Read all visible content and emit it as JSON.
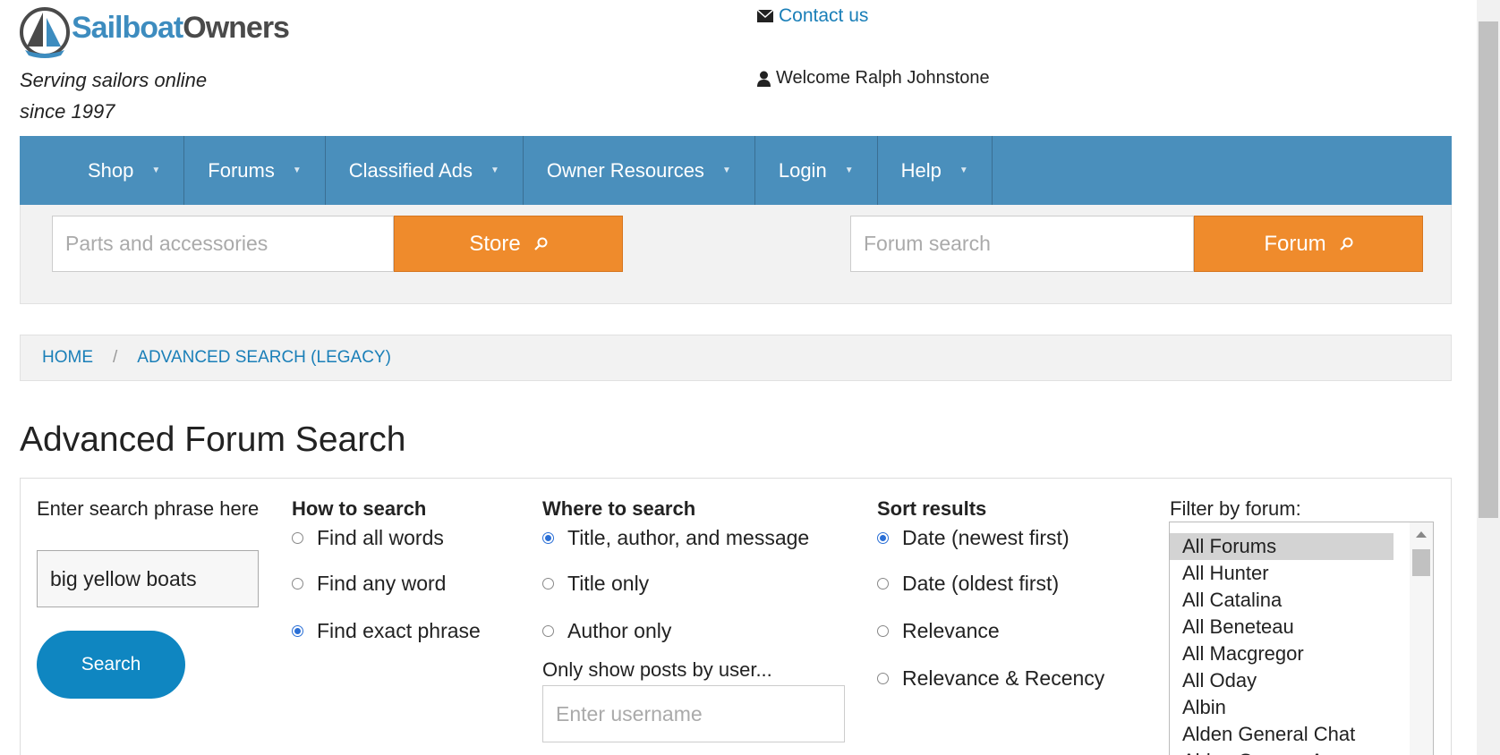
{
  "header": {
    "logo_sail": "Sailboat",
    "logo_owners": "Owners",
    "tagline_line1": "Serving sailors online",
    "tagline_line2": "since 1997",
    "contact_label": "Contact us",
    "welcome_text": "Welcome Ralph Johnstone"
  },
  "nav": {
    "items": [
      {
        "label": "Shop"
      },
      {
        "label": "Forums"
      },
      {
        "label": "Classified Ads"
      },
      {
        "label": "Owner Resources"
      },
      {
        "label": "Login"
      },
      {
        "label": "Help"
      }
    ]
  },
  "search_strip": {
    "store_placeholder": "Parts and accessories",
    "store_button": "Store",
    "forum_placeholder": "Forum search",
    "forum_button": "Forum"
  },
  "breadcrumb": {
    "home": "HOME",
    "separator": "/",
    "current": "ADVANCED SEARCH (LEGACY)"
  },
  "page_title": "Advanced Forum Search",
  "form": {
    "phrase_label": "Enter search phrase here",
    "phrase_value": "big yellow boats",
    "search_button": "Search",
    "how": {
      "heading": "How to search",
      "options": [
        {
          "label": "Find all words",
          "checked": false
        },
        {
          "label": "Find any word",
          "checked": false
        },
        {
          "label": "Find exact phrase",
          "checked": true
        }
      ]
    },
    "where": {
      "heading": "Where to search",
      "options": [
        {
          "label": "Title, author, and message",
          "checked": true
        },
        {
          "label": "Title only",
          "checked": false
        },
        {
          "label": "Author only",
          "checked": false
        }
      ],
      "user_label": "Only show posts by user...",
      "user_placeholder": "Enter username"
    },
    "sort": {
      "heading": "Sort results",
      "options": [
        {
          "label": "Date (newest first)",
          "checked": true
        },
        {
          "label": "Date (oldest first)",
          "checked": false
        },
        {
          "label": "Relevance",
          "checked": false
        },
        {
          "label": "Relevance & Recency",
          "checked": false
        }
      ]
    },
    "filter": {
      "label": "Filter by forum:",
      "items": [
        "All Forums",
        "All Hunter",
        "All Catalina",
        "All Beneteau",
        "All Macgregor",
        "All Oday",
        "Albin",
        "Alden General Chat",
        "Alden Owners Assoc"
      ],
      "selected": "All Forums"
    }
  }
}
